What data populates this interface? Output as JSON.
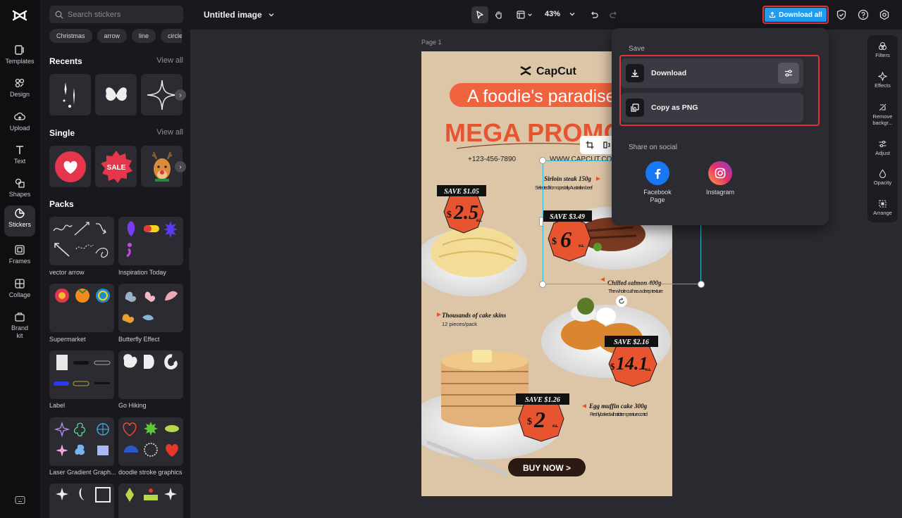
{
  "left_rail": {
    "items": [
      {
        "label": "Templates",
        "icon": "templates-icon"
      },
      {
        "label": "Design",
        "icon": "design-icon"
      },
      {
        "label": "Upload",
        "icon": "upload-icon"
      },
      {
        "label": "Text",
        "icon": "text-icon"
      },
      {
        "label": "Shapes",
        "icon": "shapes-icon"
      },
      {
        "label": "Stickers",
        "icon": "stickers-icon"
      },
      {
        "label": "Frames",
        "icon": "frames-icon"
      },
      {
        "label": "Collage",
        "icon": "collage-icon"
      },
      {
        "label": "Brand kit",
        "icon": "brand-kit-icon"
      }
    ],
    "active": "Stickers"
  },
  "stickers_panel": {
    "search_placeholder": "Search stickers",
    "chips": [
      "Christmas",
      "arrow",
      "line",
      "circle"
    ],
    "recents": {
      "title": "Recents",
      "view_all": "View all"
    },
    "single": {
      "title": "Single",
      "view_all": "View all",
      "sale_text": "SALE"
    },
    "packs": {
      "title": "Packs",
      "items": [
        "vector arrow",
        "Inspiration Today",
        "Supermarket",
        "Butterfly Effect",
        "Label",
        "Go Hiking",
        "Laser Gradient Graph...",
        "doodle stroke graphics"
      ]
    }
  },
  "topbar": {
    "doc_title": "Untitled image",
    "zoom": "43%",
    "download_all": "Download all"
  },
  "canvas": {
    "page_label": "Page 1"
  },
  "poster": {
    "brand": "CapCut",
    "headline": "A foodie's paradise",
    "promo": "MEGA PROMOTION",
    "phone": "+123-456-7890",
    "website": "WWW.CAPCUT.COM",
    "items": [
      {
        "save": "SAVE $1.05",
        "price": "2.5"
      },
      {
        "save": "SAVE $3.49",
        "price": "6",
        "name": "Sirloin steak 150g",
        "desc": "Selected from specialty Australian beef"
      },
      {
        "name": "Chilled salmon 400g",
        "desc": "The whole cut has a deep texture"
      },
      {
        "name": "Thousands of cake skins",
        "desc": "12 pieces/pack"
      },
      {
        "save": "SAVE $2.16",
        "price": "14.1"
      },
      {
        "save": "SAVE $1.26",
        "price": "2",
        "name": "Egg muffin cake 300g",
        "desc": "Freshly baked with strict temperature control"
      }
    ],
    "currency": "$",
    "unit": "ea.",
    "cta": "BUY NOW >"
  },
  "right_rail": {
    "items": [
      "Filters",
      "Effects",
      "Remove backgr...",
      "Adjust",
      "Opacity",
      "Arrange"
    ]
  },
  "download_popover": {
    "save_title": "Save",
    "download": "Download",
    "copy_png": "Copy as PNG",
    "share_title": "Share on social",
    "facebook": "Facebook Page",
    "instagram": "Instagram"
  },
  "colors": {
    "accent_blue": "#1e9cf0",
    "highlight_red": "#e0343a",
    "poster_orange": "#f0633f",
    "poster_bg": "#ddc5a8"
  }
}
